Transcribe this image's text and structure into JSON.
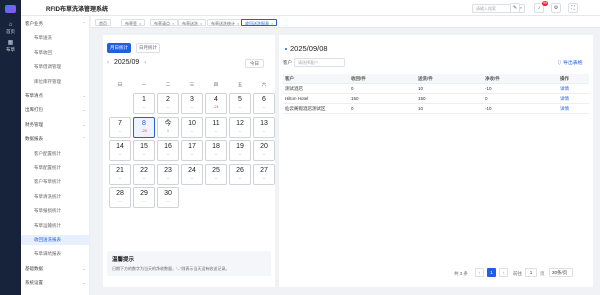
{
  "app": {
    "title": "RFID布草洗涤管理系统",
    "search_placeholder": "请输入搜索",
    "notification_count": "99"
  },
  "rail": [
    {
      "icon": "home-icon",
      "glyph": "⌂",
      "label": "首页"
    },
    {
      "icon": "grid-icon",
      "glyph": "▦",
      "label": "布草"
    }
  ],
  "sidebar": [
    {
      "label": "客户业务",
      "level": 1,
      "expanded": true
    },
    {
      "label": "布草送洗",
      "level": 2
    },
    {
      "label": "布草收回",
      "level": 2
    },
    {
      "label": "布草借调管理",
      "level": 2
    },
    {
      "label": "库位库存管理",
      "level": 2
    },
    {
      "label": "布草清点",
      "level": 1
    },
    {
      "label": "出库打包",
      "level": 1
    },
    {
      "label": "财务管理",
      "level": 1
    },
    {
      "label": "数据报表",
      "level": 1,
      "expanded": true
    },
    {
      "label": "客户配置统计",
      "level": 2
    },
    {
      "label": "布草配置统计",
      "level": 2
    },
    {
      "label": "客户布草统计",
      "level": 2
    },
    {
      "label": "布草清洗统计",
      "level": 2
    },
    {
      "label": "布草报损统计",
      "level": 2
    },
    {
      "label": "布草运输统计",
      "level": 2
    },
    {
      "label": "收回送洗报表",
      "level": 2,
      "active": true
    },
    {
      "label": "布草满坑报表",
      "level": 2
    },
    {
      "label": "基础数据",
      "level": 1
    },
    {
      "label": "系统设置",
      "level": 1
    }
  ],
  "tabs": [
    {
      "label": "首页"
    },
    {
      "label": "布草签"
    },
    {
      "label": "布草清点"
    },
    {
      "label": "布草送洗"
    },
    {
      "label": "布草送洗统计"
    },
    {
      "label": "收回送洗报表",
      "active": true
    }
  ],
  "calendar": {
    "view_buttons": [
      "月日统计",
      "日月统计"
    ],
    "month": "2025/09",
    "prev": "‹",
    "next": "›",
    "today_label": "今日",
    "weekdays": [
      "日",
      "一",
      "二",
      "三",
      "四",
      "五",
      "六"
    ],
    "days": [
      {
        "d": "1",
        "v": "--"
      },
      {
        "d": "2",
        "v": "--"
      },
      {
        "d": "3",
        "v": "--"
      },
      {
        "d": "4",
        "v": "-21"
      },
      {
        "d": "5",
        "v": "--"
      },
      {
        "d": "6",
        "v": "--"
      },
      {
        "d": "7",
        "v": "--"
      },
      {
        "d": "8",
        "v": "-20"
      },
      {
        "d": "今",
        "v": "0"
      },
      {
        "d": "10",
        "v": "--"
      },
      {
        "d": "11",
        "v": "--"
      },
      {
        "d": "12",
        "v": "--"
      },
      {
        "d": "13",
        "v": "--"
      },
      {
        "d": "14",
        "v": "--"
      },
      {
        "d": "15",
        "v": "--"
      },
      {
        "d": "16",
        "v": "--"
      },
      {
        "d": "17",
        "v": "--"
      },
      {
        "d": "18",
        "v": "--"
      },
      {
        "d": "19",
        "v": "--"
      },
      {
        "d": "20",
        "v": "--"
      },
      {
        "d": "21",
        "v": "--"
      },
      {
        "d": "22",
        "v": "--"
      },
      {
        "d": "23",
        "v": "--"
      },
      {
        "d": "24",
        "v": "--"
      },
      {
        "d": "25",
        "v": "--"
      },
      {
        "d": "26",
        "v": "--"
      },
      {
        "d": "27",
        "v": "--"
      },
      {
        "d": "28",
        "v": "--"
      },
      {
        "d": "29",
        "v": "--"
      },
      {
        "d": "30",
        "v": "--"
      }
    ],
    "selected_day": "8",
    "legend_title": "温馨提示",
    "legend_text": "日期下方的数字为当天的净收数量，“--”则表示当天没有收送记录。"
  },
  "detail": {
    "title": "2025/09/08",
    "filter_label": "客户",
    "filter_placeholder": "请选择客户",
    "export_label": "导出表格",
    "columns": [
      "客户",
      "收回/件",
      "送洗/件",
      "净收/件",
      "操作"
    ],
    "rows": [
      [
        "测试酒店",
        "0",
        "10",
        "-10",
        "详情"
      ],
      [
        "Hilton Hotel",
        "150",
        "150",
        "0",
        "详情"
      ],
      [
        "仙云阁假酒店测试区",
        "0",
        "10",
        "-10",
        "详情"
      ]
    ],
    "pagination": {
      "total": "共 3 条",
      "page": "1",
      "goto_label": "前往",
      "goto_value": "1",
      "page_unit": "页",
      "page_size": "20条/页"
    }
  }
}
